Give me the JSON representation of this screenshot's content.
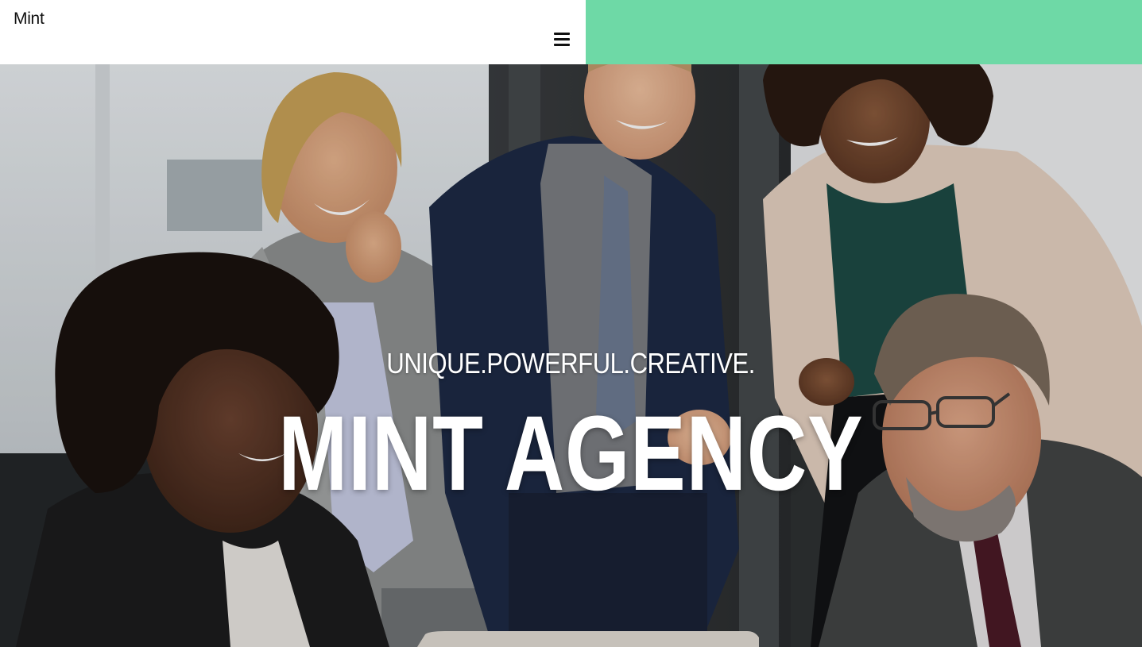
{
  "header": {
    "brand": "Mint",
    "accent_color": "#6ed9a6",
    "menu_icon": "hamburger-menu-icon"
  },
  "hero": {
    "tagline": "UNIQUE.POWERFUL.CREATIVE.",
    "title": "MINT AGENCY",
    "image": "team-meeting-photo"
  }
}
